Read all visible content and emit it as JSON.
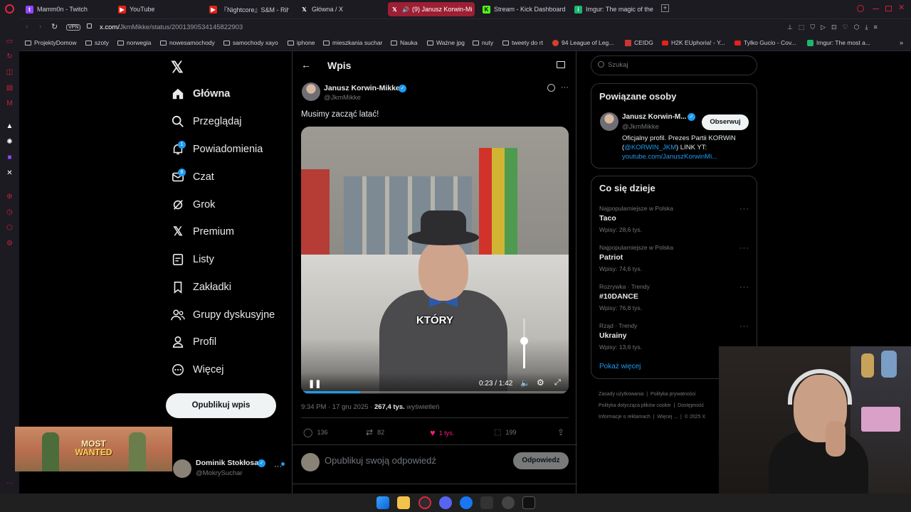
{
  "browser": {
    "tabs": [
      {
        "label": "Mamm0n - Twitch",
        "fav": "twitch-icon"
      },
      {
        "label": "YouTube",
        "fav": "youtube-icon"
      },
      {
        "label": "『Nightcore』S&M - Rihan",
        "fav": "youtube-icon"
      },
      {
        "label": "Główna / X",
        "fav": "x-icon"
      },
      {
        "label": "(9) Janusz Korwin-Mi",
        "fav": "x-icon"
      },
      {
        "label": "Stream - Kick Dashboard",
        "fav": "kick-icon"
      },
      {
        "label": "Imgur: The magic of the I",
        "fav": "imgur-icon"
      }
    ],
    "vpn_label": "VPN",
    "url_domain": "x.com/",
    "url_path": "JkmMikke/status/2001390534145822903",
    "bookmarks": [
      "ProjektyDomow",
      "szoty",
      "norwegia",
      "nowesamochody",
      "samochody xayo",
      "iphone",
      "mieszkania suchar",
      "Nauka",
      "Ważne jpg",
      "nuty",
      "tweety do rt",
      "94 League of Leg...",
      "CEIDG",
      "H2K EUphoria! - Y...",
      "Tylko Gucio - Cov...",
      "Imgur: The most a..."
    ]
  },
  "x_nav": {
    "items": [
      {
        "label": "Główna",
        "icon": "home-icon"
      },
      {
        "label": "Przeglądaj",
        "icon": "search-icon"
      },
      {
        "label": "Powiadomienia",
        "icon": "bell-icon",
        "badge": "1"
      },
      {
        "label": "Czat",
        "icon": "mail-icon",
        "badge": "8"
      },
      {
        "label": "Grok",
        "icon": "grok-icon"
      },
      {
        "label": "Premium",
        "icon": "x-logo-icon"
      },
      {
        "label": "Listy",
        "icon": "list-icon"
      },
      {
        "label": "Zakładki",
        "icon": "bookmark-icon"
      },
      {
        "label": "Grupy dyskusyjne",
        "icon": "people-icon"
      },
      {
        "label": "Profil",
        "icon": "person-icon"
      },
      {
        "label": "Więcej",
        "icon": "more-circle-icon"
      }
    ],
    "post_button": "Opublikuj wpis",
    "account_name": "Dominik Stokłosa",
    "account_handle": "@MokrySuchar"
  },
  "post": {
    "header": "Wpis",
    "author_name": "Janusz Korwin-Mikke",
    "author_handle": "@JkmMikke",
    "text": "Musimy zacząć latać!",
    "video_caption": "KTÓRY",
    "video_time": "0:23 / 1:42",
    "video_progress": 0.22,
    "volume_level": 0.55,
    "meta_time": "9:34 PM · 17 gru 2025 · ",
    "views_count": "267,4 tys.",
    "views_label": " wyświetleń",
    "replies": "136",
    "reposts": "82",
    "likes": "1 tys.",
    "bookmarks": "199",
    "reply_placeholder": "Opublikuj swoją odpowiedź",
    "reply_button": "Odpowiedz"
  },
  "right": {
    "search_placeholder": "Szukaj",
    "related_title": "Powiązane osoby",
    "related_name": "Janusz Korwin-M...",
    "related_handle": "@JkmMikke",
    "follow_button": "Obserwuj",
    "bio_pre": "Oficjalny profil. Prezes Partii KORWiN (",
    "bio_mention": "@KORWIN_JKM",
    "bio_mid": ") LINK YT:",
    "bio_link": "youtube.com/JanuszKorwinMi...",
    "trends_title": "Co się dzieje",
    "trends": [
      {
        "meta": "Najpopularniejsze w Polska",
        "name": "Taco",
        "count": "Wpisy: 28,6 tys."
      },
      {
        "meta": "Najpopularniejsze w Polska",
        "name": "Patriot",
        "count": "Wpisy: 74,6 tys."
      },
      {
        "meta": "Rozrywka · Trendy",
        "name": "#10DANCE",
        "count": "Wpisy: 76,8 tys."
      },
      {
        "meta": "Rząd · Trendy",
        "name": "Ukrainy",
        "count": "Wpisy: 13,6 tys."
      }
    ],
    "show_more": "Pokaż więcej",
    "footer": [
      "Zasady użytkowania",
      "Polityka prywatności",
      "Polityka dotycząca plików cookie",
      "Dostępność",
      "Informacje o reklamach",
      "Więcej ...",
      "© 2025 X"
    ]
  },
  "overlay": {
    "line1": "MOST",
    "line2": "WANTED"
  },
  "colors": {
    "accent": "#1d9bf0",
    "opera_red": "#c9223a",
    "like_pink": "#f91880"
  }
}
